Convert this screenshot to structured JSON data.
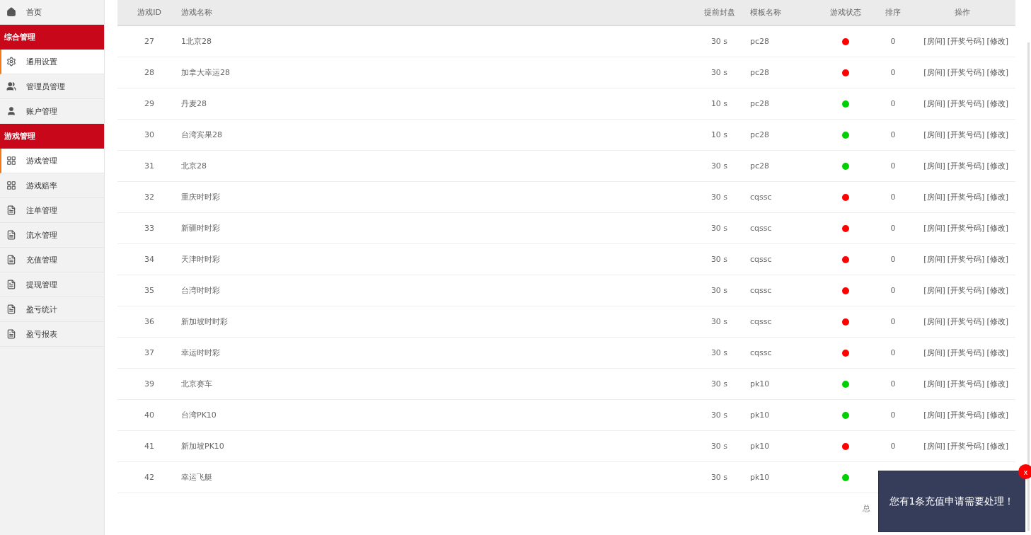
{
  "sidebar": {
    "items": [
      {
        "kind": "link",
        "label": "首页",
        "selected": false
      },
      {
        "kind": "header",
        "label": "综合管理"
      },
      {
        "kind": "link",
        "label": "通用设置",
        "selected": true
      },
      {
        "kind": "link",
        "label": "管理员管理",
        "selected": false
      },
      {
        "kind": "link",
        "label": "账户管理",
        "selected": false
      },
      {
        "kind": "header",
        "label": "游戏管理"
      },
      {
        "kind": "link",
        "label": "游戏管理",
        "selected": true
      },
      {
        "kind": "link",
        "label": "游戏赔率",
        "selected": false
      },
      {
        "kind": "link",
        "label": "注单管理",
        "selected": false
      },
      {
        "kind": "link",
        "label": "流水管理",
        "selected": false
      },
      {
        "kind": "link",
        "label": "充值管理",
        "selected": false
      },
      {
        "kind": "link",
        "label": "提现管理",
        "selected": false
      },
      {
        "kind": "link",
        "label": "盈亏统计",
        "selected": false
      },
      {
        "kind": "link",
        "label": "盈亏报表",
        "selected": false
      }
    ]
  },
  "table": {
    "columns": [
      "游戏ID",
      "游戏名称",
      "提前封盘",
      "模板名称",
      "游戏状态",
      "排序",
      "操作"
    ],
    "rows": [
      {
        "id": "27",
        "name": "1北京28",
        "cutoff": "30 s",
        "template": "pc28",
        "on": false,
        "sort": "0",
        "actions": [
          "[房间]",
          "[开奖号码]",
          "[修改]"
        ]
      },
      {
        "id": "28",
        "name": "加拿大幸运28",
        "cutoff": "30 s",
        "template": "pc28",
        "on": false,
        "sort": "0",
        "actions": [
          "[房间]",
          "[开奖号码]",
          "[修改]"
        ]
      },
      {
        "id": "29",
        "name": "丹麦28",
        "cutoff": "10 s",
        "template": "pc28",
        "on": true,
        "sort": "0",
        "actions": [
          "[房间]",
          "[开奖号码]",
          "[修改]"
        ]
      },
      {
        "id": "30",
        "name": "台湾宾果28",
        "cutoff": "10 s",
        "template": "pc28",
        "on": true,
        "sort": "0",
        "actions": [
          "[房间]",
          "[开奖号码]",
          "[修改]"
        ]
      },
      {
        "id": "31",
        "name": "北京28",
        "cutoff": "30 s",
        "template": "pc28",
        "on": true,
        "sort": "0",
        "actions": [
          "[房间]",
          "[开奖号码]",
          "[修改]"
        ]
      },
      {
        "id": "32",
        "name": "重庆时时彩",
        "cutoff": "30 s",
        "template": "cqssc",
        "on": false,
        "sort": "0",
        "actions": [
          "[房间]",
          "[开奖号码]",
          "[修改]"
        ]
      },
      {
        "id": "33",
        "name": "新疆时时彩",
        "cutoff": "30 s",
        "template": "cqssc",
        "on": false,
        "sort": "0",
        "actions": [
          "[房间]",
          "[开奖号码]",
          "[修改]"
        ]
      },
      {
        "id": "34",
        "name": "天津时时彩",
        "cutoff": "30 s",
        "template": "cqssc",
        "on": false,
        "sort": "0",
        "actions": [
          "[房间]",
          "[开奖号码]",
          "[修改]"
        ]
      },
      {
        "id": "35",
        "name": "台湾时时彩",
        "cutoff": "30 s",
        "template": "cqssc",
        "on": false,
        "sort": "0",
        "actions": [
          "[房间]",
          "[开奖号码]",
          "[修改]"
        ]
      },
      {
        "id": "36",
        "name": "新加坡时时彩",
        "cutoff": "30 s",
        "template": "cqssc",
        "on": false,
        "sort": "0",
        "actions": [
          "[房间]",
          "[开奖号码]",
          "[修改]"
        ]
      },
      {
        "id": "37",
        "name": "幸运时时彩",
        "cutoff": "30 s",
        "template": "cqssc",
        "on": false,
        "sort": "0",
        "actions": [
          "[房间]",
          "[开奖号码]",
          "[修改]"
        ]
      },
      {
        "id": "39",
        "name": "北京赛车",
        "cutoff": "30 s",
        "template": "pk10",
        "on": true,
        "sort": "0",
        "actions": [
          "[房间]",
          "[开奖号码]",
          "[修改]"
        ]
      },
      {
        "id": "40",
        "name": "台湾PK10",
        "cutoff": "30 s",
        "template": "pk10",
        "on": true,
        "sort": "0",
        "actions": [
          "[房间]",
          "[开奖号码]",
          "[修改]"
        ]
      },
      {
        "id": "41",
        "name": "新加坡PK10",
        "cutoff": "30 s",
        "template": "pk10",
        "on": false,
        "sort": "0",
        "actions": [
          "[房间]",
          "[开奖号码]",
          "[修改]"
        ]
      },
      {
        "id": "42",
        "name": "幸运飞艇",
        "cutoff": "30 s",
        "template": "pk10",
        "on": true
      }
    ]
  },
  "pager": {
    "text": "总"
  },
  "toast": {
    "message": "您有1条充值申请需要处理！",
    "close": "x"
  }
}
